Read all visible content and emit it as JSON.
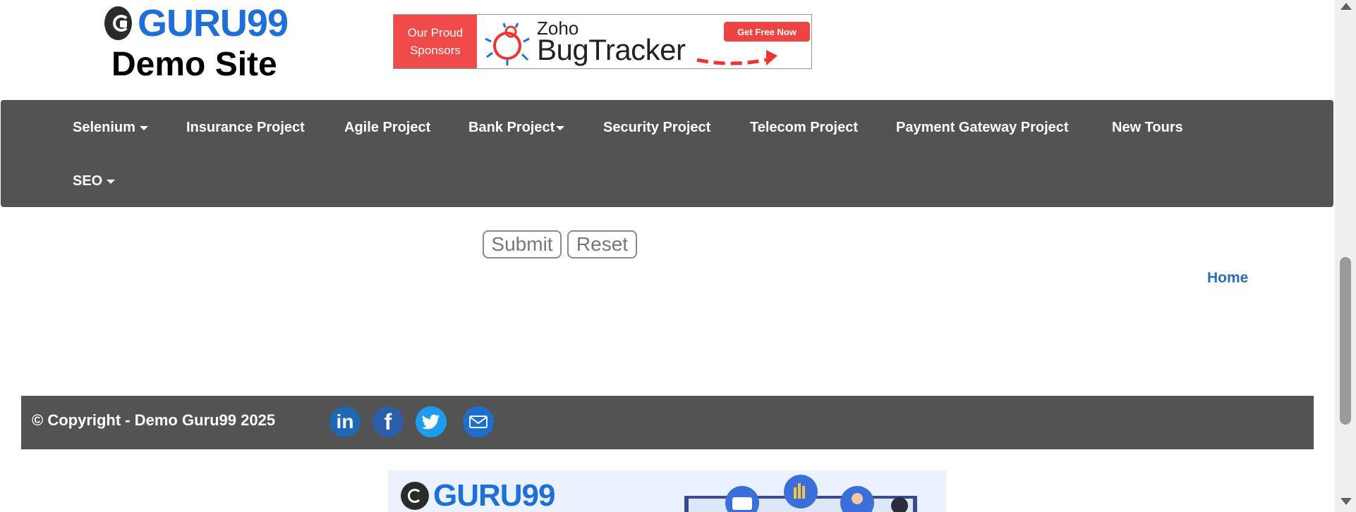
{
  "header": {
    "logo_text": "GURU99",
    "site_title": "Demo Site",
    "sponsor": {
      "label_line1": "Our Proud",
      "label_line2": "Sponsors",
      "brand_small": "Zoho",
      "brand_large": "BugTracker",
      "cta": "Get Free Now"
    }
  },
  "nav": {
    "items": [
      {
        "label": "Selenium",
        "dropdown": true
      },
      {
        "label": "Insurance Project",
        "dropdown": false
      },
      {
        "label": "Agile Project",
        "dropdown": false
      },
      {
        "label": "Bank Project",
        "dropdown": true
      },
      {
        "label": "Security Project",
        "dropdown": false
      },
      {
        "label": "Telecom Project",
        "dropdown": false
      },
      {
        "label": "Payment Gateway Project",
        "dropdown": false
      },
      {
        "label": "New Tours",
        "dropdown": false
      },
      {
        "label": "SEO",
        "dropdown": true
      }
    ]
  },
  "form": {
    "submit_label": "Submit",
    "reset_label": "Reset"
  },
  "home_link": "Home",
  "footer": {
    "copyright": "© Copyright - Demo Guru99 2025",
    "social": [
      "linkedin-icon",
      "facebook-icon",
      "twitter-icon",
      "email-icon"
    ]
  },
  "banner": {
    "logo_text": "GURU99"
  },
  "colors": {
    "nav_bg": "#535353",
    "brand_blue": "#1e6fd9",
    "sponsor_red": "#f04b4b",
    "link_blue": "#2a6eb3"
  }
}
